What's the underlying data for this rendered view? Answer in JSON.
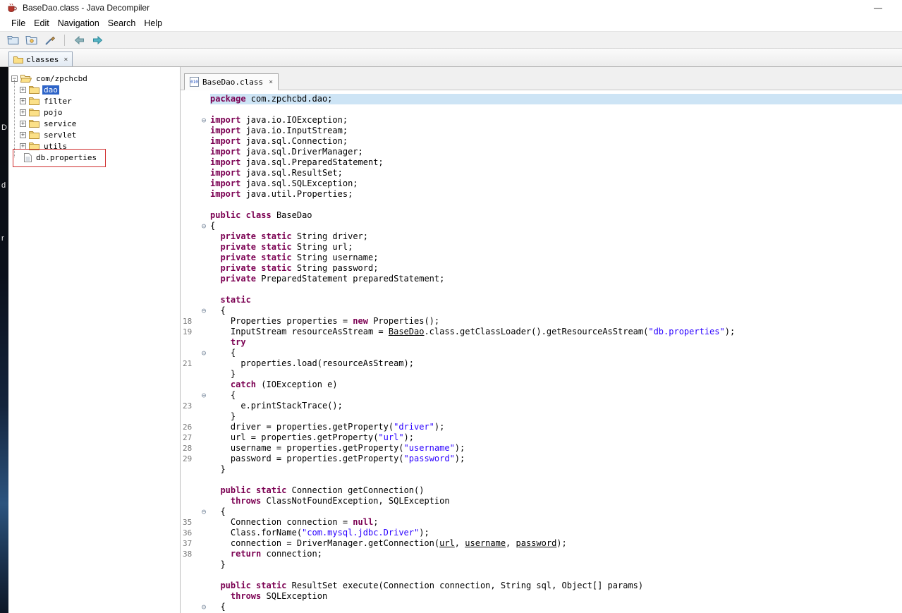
{
  "window": {
    "title": "BaseDao.class - Java Decompiler",
    "minimize_label": "—"
  },
  "menu": {
    "items": [
      "File",
      "Edit",
      "Navigation",
      "Search",
      "Help"
    ]
  },
  "toolbar": {
    "buttons": [
      "open-file",
      "open-type",
      "search",
      "back",
      "forward"
    ]
  },
  "workspace_tab": {
    "label": "classes",
    "close_label": "×"
  },
  "tree": {
    "root_label": "com/zpchcbd",
    "collapse_glyph": "−",
    "expand_glyph": "+",
    "items": [
      {
        "label": "dao",
        "type": "folder",
        "selected": true
      },
      {
        "label": "filter",
        "type": "folder",
        "selected": false
      },
      {
        "label": "pojo",
        "type": "folder",
        "selected": false
      },
      {
        "label": "service",
        "type": "folder",
        "selected": false
      },
      {
        "label": "servlet",
        "type": "folder",
        "selected": false
      },
      {
        "label": "utils",
        "type": "folder",
        "selected": false
      },
      {
        "label": "db.properties",
        "type": "file",
        "selected": false,
        "annotated": true
      }
    ]
  },
  "desktop": {
    "letters": [
      "D",
      "d",
      "r"
    ]
  },
  "editor": {
    "tab": {
      "label": "BaseDao.class",
      "close_label": "×",
      "icon_glyph": "010"
    },
    "fold_glyph": "⊖",
    "colors": {
      "keyword": "#7B0052",
      "string": "#2A00FF",
      "line_highlight": "#cde4f5",
      "tree_selection": "#2e64c8",
      "annotation": "#cf2b2b",
      "line_number": "#7a7a7a"
    },
    "code": {
      "lines": [
        {
          "h": true,
          "s": [
            [
              "k",
              "package"
            ],
            [
              "p",
              " com.zpchcbd.dao;"
            ]
          ]
        },
        {
          "s": []
        },
        {
          "f": true,
          "s": [
            [
              "k",
              "import"
            ],
            [
              "p",
              " java.io.IOException;"
            ]
          ]
        },
        {
          "s": [
            [
              "k",
              "import"
            ],
            [
              "p",
              " java.io.InputStream;"
            ]
          ]
        },
        {
          "s": [
            [
              "k",
              "import"
            ],
            [
              "p",
              " java.sql.Connection;"
            ]
          ]
        },
        {
          "s": [
            [
              "k",
              "import"
            ],
            [
              "p",
              " java.sql.DriverManager;"
            ]
          ]
        },
        {
          "s": [
            [
              "k",
              "import"
            ],
            [
              "p",
              " java.sql.PreparedStatement;"
            ]
          ]
        },
        {
          "s": [
            [
              "k",
              "import"
            ],
            [
              "p",
              " java.sql.ResultSet;"
            ]
          ]
        },
        {
          "s": [
            [
              "k",
              "import"
            ],
            [
              "p",
              " java.sql.SQLException;"
            ]
          ]
        },
        {
          "s": [
            [
              "k",
              "import"
            ],
            [
              "p",
              " java.util.Properties;"
            ]
          ]
        },
        {
          "s": []
        },
        {
          "s": [
            [
              "k",
              "public"
            ],
            [
              "p",
              " "
            ],
            [
              "k",
              "class"
            ],
            [
              "p",
              " BaseDao"
            ]
          ]
        },
        {
          "f": true,
          "s": [
            [
              "p",
              "{"
            ]
          ]
        },
        {
          "s": [
            [
              "p",
              "  "
            ],
            [
              "k",
              "private"
            ],
            [
              "p",
              " "
            ],
            [
              "k",
              "static"
            ],
            [
              "p",
              " String driver;"
            ]
          ]
        },
        {
          "s": [
            [
              "p",
              "  "
            ],
            [
              "k",
              "private"
            ],
            [
              "p",
              " "
            ],
            [
              "k",
              "static"
            ],
            [
              "p",
              " String url;"
            ]
          ]
        },
        {
          "s": [
            [
              "p",
              "  "
            ],
            [
              "k",
              "private"
            ],
            [
              "p",
              " "
            ],
            [
              "k",
              "static"
            ],
            [
              "p",
              " String username;"
            ]
          ]
        },
        {
          "s": [
            [
              "p",
              "  "
            ],
            [
              "k",
              "private"
            ],
            [
              "p",
              " "
            ],
            [
              "k",
              "static"
            ],
            [
              "p",
              " String password;"
            ]
          ]
        },
        {
          "s": [
            [
              "p",
              "  "
            ],
            [
              "k",
              "private"
            ],
            [
              "p",
              " PreparedStatement preparedStatement;"
            ]
          ]
        },
        {
          "s": []
        },
        {
          "s": [
            [
              "p",
              "  "
            ],
            [
              "k",
              "static"
            ]
          ]
        },
        {
          "f": true,
          "s": [
            [
              "p",
              "  {"
            ]
          ]
        },
        {
          "n": "18",
          "s": [
            [
              "p",
              "    Properties properties = "
            ],
            [
              "k",
              "new"
            ],
            [
              "p",
              " Properties();"
            ]
          ]
        },
        {
          "n": "19",
          "s": [
            [
              "p",
              "    InputStream resourceAsStream = "
            ],
            [
              "l",
              "BaseDao"
            ],
            [
              "p",
              ".class.getClassLoader().getResourceAsStream("
            ],
            [
              "t",
              "\"db.properties\""
            ],
            [
              "p",
              ");"
            ]
          ]
        },
        {
          "s": [
            [
              "p",
              "    "
            ],
            [
              "k",
              "try"
            ]
          ]
        },
        {
          "f": true,
          "s": [
            [
              "p",
              "    {"
            ]
          ]
        },
        {
          "n": "21",
          "s": [
            [
              "p",
              "      properties.load(resourceAsStream);"
            ]
          ]
        },
        {
          "s": [
            [
              "p",
              "    }"
            ]
          ]
        },
        {
          "s": [
            [
              "p",
              "    "
            ],
            [
              "k",
              "catch"
            ],
            [
              "p",
              " (IOException e)"
            ]
          ]
        },
        {
          "f": true,
          "s": [
            [
              "p",
              "    {"
            ]
          ]
        },
        {
          "n": "23",
          "s": [
            [
              "p",
              "      e.printStackTrace();"
            ]
          ]
        },
        {
          "s": [
            [
              "p",
              "    }"
            ]
          ]
        },
        {
          "n": "26",
          "s": [
            [
              "p",
              "    driver = properties.getProperty("
            ],
            [
              "t",
              "\"driver\""
            ],
            [
              "p",
              ");"
            ]
          ]
        },
        {
          "n": "27",
          "s": [
            [
              "p",
              "    url = properties.getProperty("
            ],
            [
              "t",
              "\"url\""
            ],
            [
              "p",
              ");"
            ]
          ]
        },
        {
          "n": "28",
          "s": [
            [
              "p",
              "    username = properties.getProperty("
            ],
            [
              "t",
              "\"username\""
            ],
            [
              "p",
              ");"
            ]
          ]
        },
        {
          "n": "29",
          "s": [
            [
              "p",
              "    password = properties.getProperty("
            ],
            [
              "t",
              "\"password\""
            ],
            [
              "p",
              ");"
            ]
          ]
        },
        {
          "s": [
            [
              "p",
              "  }"
            ]
          ]
        },
        {
          "s": []
        },
        {
          "s": [
            [
              "p",
              "  "
            ],
            [
              "k",
              "public"
            ],
            [
              "p",
              " "
            ],
            [
              "k",
              "static"
            ],
            [
              "p",
              " Connection getConnection()"
            ]
          ]
        },
        {
          "s": [
            [
              "p",
              "    "
            ],
            [
              "k",
              "throws"
            ],
            [
              "p",
              " ClassNotFoundException, SQLException"
            ]
          ]
        },
        {
          "f": true,
          "s": [
            [
              "p",
              "  {"
            ]
          ]
        },
        {
          "n": "35",
          "s": [
            [
              "p",
              "    Connection connection = "
            ],
            [
              "k",
              "null"
            ],
            [
              "p",
              ";"
            ]
          ]
        },
        {
          "n": "36",
          "s": [
            [
              "p",
              "    Class.forName("
            ],
            [
              "t",
              "\"com.mysql.jdbc.Driver\""
            ],
            [
              "p",
              ");"
            ]
          ]
        },
        {
          "n": "37",
          "s": [
            [
              "p",
              "    connection = DriverManager.getConnection("
            ],
            [
              "l",
              "url"
            ],
            [
              "p",
              ", "
            ],
            [
              "l",
              "username"
            ],
            [
              "p",
              ", "
            ],
            [
              "l",
              "password"
            ],
            [
              "p",
              ");"
            ]
          ]
        },
        {
          "n": "38",
          "s": [
            [
              "p",
              "    "
            ],
            [
              "k",
              "return"
            ],
            [
              "p",
              " connection;"
            ]
          ]
        },
        {
          "s": [
            [
              "p",
              "  }"
            ]
          ]
        },
        {
          "s": []
        },
        {
          "s": [
            [
              "p",
              "  "
            ],
            [
              "k",
              "public"
            ],
            [
              "p",
              " "
            ],
            [
              "k",
              "static"
            ],
            [
              "p",
              " ResultSet execute(Connection connection, String sql, Object[] params)"
            ]
          ]
        },
        {
          "s": [
            [
              "p",
              "    "
            ],
            [
              "k",
              "throws"
            ],
            [
              "p",
              " SQLException"
            ]
          ]
        },
        {
          "f": true,
          "s": [
            [
              "p",
              "  {"
            ]
          ]
        }
      ]
    }
  }
}
